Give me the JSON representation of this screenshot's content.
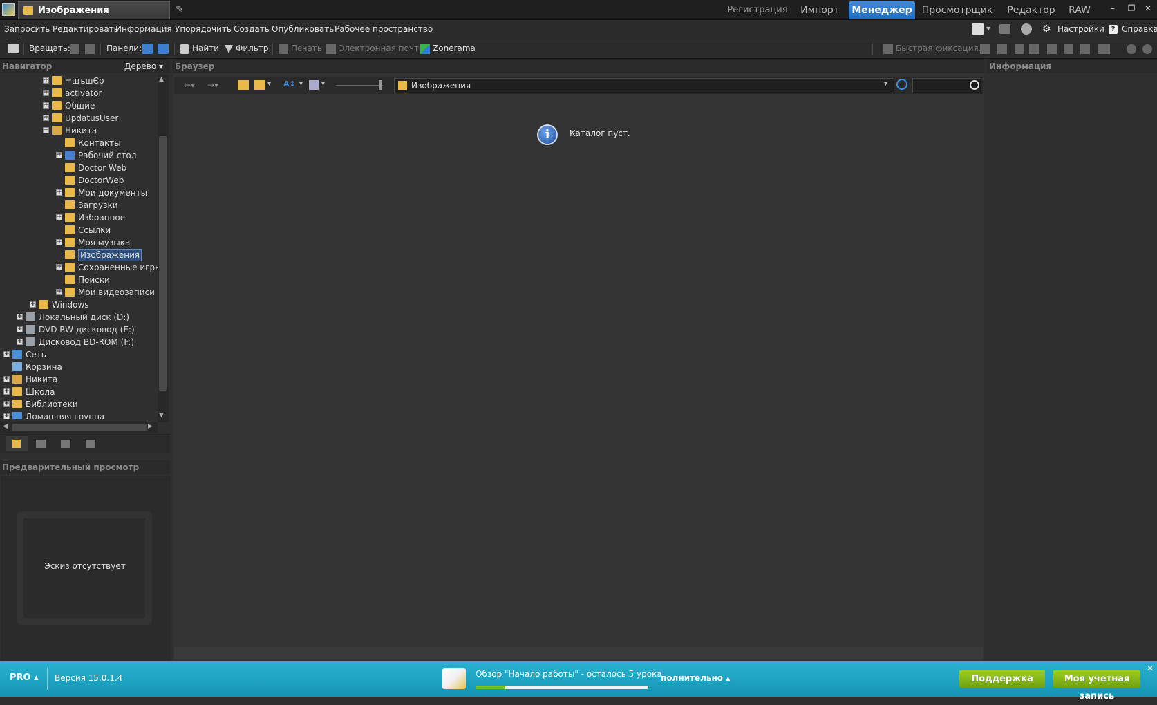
{
  "titlebar": {
    "doc_tab": "Изображения",
    "mode_tabs": [
      "Регистрация",
      "Импорт",
      "Менеджер",
      "Просмотрщик",
      "Редактор",
      "RAW"
    ],
    "active_mode": "Менеджер",
    "win_min": "–",
    "win_restore": "❐",
    "win_close": "✕"
  },
  "menu": {
    "items": [
      "Запросить",
      "Редактировать",
      "Информация",
      "Упорядочить",
      "Создать",
      "Опубликовать",
      "Рабочее пространство"
    ],
    "settings": "Настройки",
    "help": "Справка"
  },
  "toolbar": {
    "rotate_label": "Вращать:",
    "panels_label": "Панели:",
    "find": "Найти",
    "filter": "Фильтр",
    "print": "Печать",
    "email": "Электронная почта",
    "zonerama": "Zonerama",
    "quick_fix": "Быстрая фиксация..."
  },
  "navigator": {
    "title": "Навигатор",
    "view_mode": "Дерево",
    "tree": [
      {
        "label": "=шъшЄр",
        "expander": "+",
        "depth": 3,
        "color": "#e8b84a"
      },
      {
        "label": "activator",
        "expander": "+",
        "depth": 3,
        "color": "#e8b84a"
      },
      {
        "label": "Общие",
        "expander": "+",
        "depth": 3,
        "color": "#e8b84a"
      },
      {
        "label": "UpdatusUser",
        "expander": "+",
        "depth": 3,
        "color": "#e8b84a"
      },
      {
        "label": "Никита",
        "expander": "−",
        "depth": 3,
        "color": "#d9a84a"
      },
      {
        "label": "Контакты",
        "expander": "",
        "depth": 4,
        "color": "#e8b84a"
      },
      {
        "label": "Рабочий стол",
        "expander": "+",
        "depth": 4,
        "color": "#4a7fd0"
      },
      {
        "label": "Doctor Web",
        "expander": "",
        "depth": 4,
        "color": "#e8b84a"
      },
      {
        "label": "DoctorWeb",
        "expander": "",
        "depth": 4,
        "color": "#e8b84a"
      },
      {
        "label": "Мои документы",
        "expander": "+",
        "depth": 4,
        "color": "#e8b84a"
      },
      {
        "label": "Загрузки",
        "expander": "",
        "depth": 4,
        "color": "#e8b84a"
      },
      {
        "label": "Избранное",
        "expander": "+",
        "depth": 4,
        "color": "#e8b84a"
      },
      {
        "label": "Ссылки",
        "expander": "",
        "depth": 4,
        "color": "#e8b84a"
      },
      {
        "label": "Моя музыка",
        "expander": "+",
        "depth": 4,
        "color": "#e8b84a"
      },
      {
        "label": "Изображения",
        "expander": "",
        "depth": 4,
        "color": "#e8b84a",
        "selected": true
      },
      {
        "label": "Сохраненные игры",
        "expander": "+",
        "depth": 4,
        "color": "#e8b84a"
      },
      {
        "label": "Поиски",
        "expander": "",
        "depth": 4,
        "color": "#e8b84a"
      },
      {
        "label": "Мои видеозаписи",
        "expander": "+",
        "depth": 4,
        "color": "#e8b84a"
      },
      {
        "label": "Windows",
        "expander": "+",
        "depth": 2,
        "color": "#e8b84a"
      },
      {
        "label": "Локальный диск (D:)",
        "expander": "+",
        "depth": 1,
        "color": "#9aa0a6"
      },
      {
        "label": "DVD RW дисковод (E:)",
        "expander": "+",
        "depth": 1,
        "color": "#9aa0a6"
      },
      {
        "label": "Дисковод BD-ROM (F:)",
        "expander": "+",
        "depth": 1,
        "color": "#9aa0a6"
      },
      {
        "label": "Сеть",
        "expander": "+",
        "depth": 0,
        "color": "#4a90d9"
      },
      {
        "label": "Корзина",
        "expander": "",
        "depth": 0,
        "color": "#7ab0e0"
      },
      {
        "label": "Никита",
        "expander": "+",
        "depth": 0,
        "color": "#d9a84a"
      },
      {
        "label": "Школа",
        "expander": "+",
        "depth": 0,
        "color": "#e8b84a"
      },
      {
        "label": "Библиотеки",
        "expander": "+",
        "depth": 0,
        "color": "#e8b84a"
      },
      {
        "label": "Домашняя группа",
        "expander": "+",
        "depth": 0,
        "color": "#4a90d9"
      }
    ]
  },
  "preview": {
    "title": "Предварительный просмотр",
    "empty_text": "Эскиз отсутствует"
  },
  "browser": {
    "title": "Браузер",
    "path": "Изображения",
    "empty_message": "Каталог пуст."
  },
  "info_panel": {
    "title": "Информация"
  },
  "bottom": {
    "edition": "PRO ▴",
    "version": "Версия 15.0.1.4",
    "tutorial": "Обзор \"Начало работы\" - осталось 5 урока",
    "more": "полнительно ▴",
    "progress": 0.17,
    "support_button": "Поддержка",
    "account_button": "Моя учетная запись",
    "close": "✕"
  },
  "colors": {
    "accent": "#1f6bbf",
    "bottom_bar": "#1ea5c4",
    "green_button": "#8cc21c"
  }
}
